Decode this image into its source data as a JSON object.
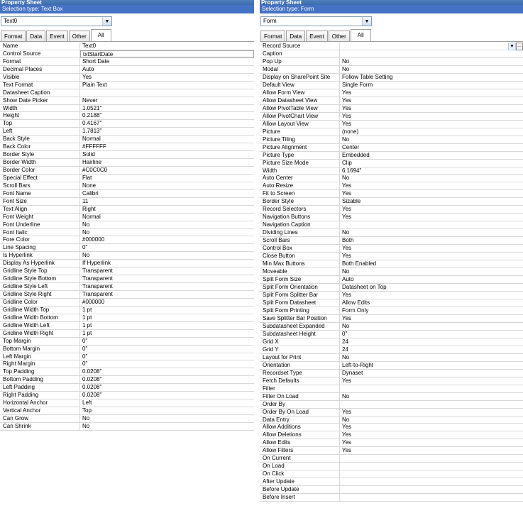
{
  "left": {
    "title": "Property Sheet",
    "selection_label": "Selection type:",
    "selection_value": "Text Box",
    "combo_value": "Text0",
    "tabs": [
      "Format",
      "Data",
      "Event",
      "Other",
      "All"
    ],
    "active_tab": "All",
    "rows": [
      {
        "name": "Name",
        "value": "Text0"
      },
      {
        "name": "Control Source",
        "value": "txtStartDate"
      },
      {
        "name": "Format",
        "value": "Short Date"
      },
      {
        "name": "Decimal Places",
        "value": "Auto"
      },
      {
        "name": "Visible",
        "value": "Yes"
      },
      {
        "name": "Text Format",
        "value": "Plain Text"
      },
      {
        "name": "Datasheet Caption",
        "value": ""
      },
      {
        "name": "Show Date Picker",
        "value": "Never"
      },
      {
        "name": "Width",
        "value": "1.0521\""
      },
      {
        "name": "Height",
        "value": "0.2188\""
      },
      {
        "name": "Top",
        "value": "0.4167\""
      },
      {
        "name": "Left",
        "value": "1.7813\""
      },
      {
        "name": "Back Style",
        "value": "Normal"
      },
      {
        "name": "Back Color",
        "value": "#FFFFFF"
      },
      {
        "name": "Border Style",
        "value": "Solid"
      },
      {
        "name": "Border Width",
        "value": "Hairline"
      },
      {
        "name": "Border Color",
        "value": "#C0C0C0"
      },
      {
        "name": "Special Effect",
        "value": "Flat"
      },
      {
        "name": "Scroll Bars",
        "value": "None"
      },
      {
        "name": "Font Name",
        "value": "Calibri"
      },
      {
        "name": "Font Size",
        "value": "11"
      },
      {
        "name": "Text Align",
        "value": "Right"
      },
      {
        "name": "Font Weight",
        "value": "Normal"
      },
      {
        "name": "Font Underline",
        "value": "No"
      },
      {
        "name": "Font Italic",
        "value": "No"
      },
      {
        "name": "Fore Color",
        "value": "#000000"
      },
      {
        "name": "Line Spacing",
        "value": "0\""
      },
      {
        "name": "Is Hyperlink",
        "value": "No"
      },
      {
        "name": "Display As Hyperlink",
        "value": "If Hyperlink"
      },
      {
        "name": "Gridline Style Top",
        "value": "Transparent"
      },
      {
        "name": "Gridline Style Bottom",
        "value": "Transparent"
      },
      {
        "name": "Gridline Style Left",
        "value": "Transparent"
      },
      {
        "name": "Gridline Style Right",
        "value": "Transparent"
      },
      {
        "name": "Gridline Color",
        "value": "#000000"
      },
      {
        "name": "Gridline Width Top",
        "value": "1 pt"
      },
      {
        "name": "Gridline Width Bottom",
        "value": "1 pt"
      },
      {
        "name": "Gridline Width Left",
        "value": "1 pt"
      },
      {
        "name": "Gridline Width Right",
        "value": "1 pt"
      },
      {
        "name": "Top Margin",
        "value": "0\""
      },
      {
        "name": "Bottom Margin",
        "value": "0\""
      },
      {
        "name": "Left Margin",
        "value": "0\""
      },
      {
        "name": "Right Margin",
        "value": "0\""
      },
      {
        "name": "Top Padding",
        "value": "0.0208\""
      },
      {
        "name": "Bottom Padding",
        "value": "0.0208\""
      },
      {
        "name": "Left Padding",
        "value": "0.0208\""
      },
      {
        "name": "Right Padding",
        "value": "0.0208\""
      },
      {
        "name": "Horizontal Anchor",
        "value": "Left"
      },
      {
        "name": "Vertical Anchor",
        "value": "Top"
      },
      {
        "name": "Can Grow",
        "value": "No"
      },
      {
        "name": "Can Shrink",
        "value": "No"
      }
    ]
  },
  "right": {
    "title": "Property Sheet",
    "selection_label": "Selection type:",
    "selection_value": "Form",
    "combo_value": "Form",
    "tabs": [
      "Format",
      "Data",
      "Event",
      "Other",
      "All"
    ],
    "active_tab": "All",
    "rows": [
      {
        "name": "Record Source",
        "value": ""
      },
      {
        "name": "Caption",
        "value": ""
      },
      {
        "name": "Pop Up",
        "value": "No"
      },
      {
        "name": "Modal",
        "value": "No"
      },
      {
        "name": "Display on SharePoint Site",
        "value": "Follow Table Setting"
      },
      {
        "name": "Default View",
        "value": "Single Form"
      },
      {
        "name": "Allow Form View",
        "value": "Yes"
      },
      {
        "name": "Allow Datasheet View",
        "value": "Yes"
      },
      {
        "name": "Allow PivotTable View",
        "value": "Yes"
      },
      {
        "name": "Allow PivotChart View",
        "value": "Yes"
      },
      {
        "name": "Allow Layout View",
        "value": "Yes"
      },
      {
        "name": "Picture",
        "value": "(none)"
      },
      {
        "name": "Picture Tiling",
        "value": "No"
      },
      {
        "name": "Picture Alignment",
        "value": "Center"
      },
      {
        "name": "Picture Type",
        "value": "Embedded"
      },
      {
        "name": "Picture Size Mode",
        "value": "Clip"
      },
      {
        "name": "Width",
        "value": "6.1694\""
      },
      {
        "name": "Auto Center",
        "value": "No"
      },
      {
        "name": "Auto Resize",
        "value": "Yes"
      },
      {
        "name": "Fit to Screen",
        "value": "Yes"
      },
      {
        "name": "Border Style",
        "value": "Sizable"
      },
      {
        "name": "Record Selectors",
        "value": "Yes"
      },
      {
        "name": "Navigation Buttons",
        "value": "Yes"
      },
      {
        "name": "Navigation Caption",
        "value": ""
      },
      {
        "name": "Dividing Lines",
        "value": "No"
      },
      {
        "name": "Scroll Bars",
        "value": "Both"
      },
      {
        "name": "Control Box",
        "value": "Yes"
      },
      {
        "name": "Close Button",
        "value": "Yes"
      },
      {
        "name": "Min Max Buttons",
        "value": "Both Enabled"
      },
      {
        "name": "Moveable",
        "value": "No"
      },
      {
        "name": "Split Form Size",
        "value": "Auto"
      },
      {
        "name": "Split Form Orientation",
        "value": "Datasheet on Top"
      },
      {
        "name": "Split Form Splitter Bar",
        "value": "Yes"
      },
      {
        "name": "Split Form Datasheet",
        "value": "Allow Edits"
      },
      {
        "name": "Split Form Printing",
        "value": "Form Only"
      },
      {
        "name": "Save Splitter Bar Position",
        "value": "Yes"
      },
      {
        "name": "Subdatasheet Expanded",
        "value": "No"
      },
      {
        "name": "Subdatasheet Height",
        "value": "0\""
      },
      {
        "name": "Grid X",
        "value": "24"
      },
      {
        "name": "Grid Y",
        "value": "24"
      },
      {
        "name": "Layout for Print",
        "value": "No"
      },
      {
        "name": "Orientation",
        "value": "Left-to-Right"
      },
      {
        "name": "Recordset Type",
        "value": "Dynaset"
      },
      {
        "name": "Fetch Defaults",
        "value": "Yes"
      },
      {
        "name": "Filter",
        "value": ""
      },
      {
        "name": "Filter On Load",
        "value": "No"
      },
      {
        "name": "Order By",
        "value": ""
      },
      {
        "name": "Order By On Load",
        "value": "Yes"
      },
      {
        "name": "Data Entry",
        "value": "No"
      },
      {
        "name": "Allow Additions",
        "value": "Yes"
      },
      {
        "name": "Allow Deletions",
        "value": "Yes"
      },
      {
        "name": "Allow Edits",
        "value": "Yes"
      },
      {
        "name": "Allow Filters",
        "value": "Yes"
      },
      {
        "name": "On Current",
        "value": ""
      },
      {
        "name": "On Load",
        "value": ""
      },
      {
        "name": "On Click",
        "value": ""
      },
      {
        "name": "After Update",
        "value": ""
      },
      {
        "name": "Before Update",
        "value": ""
      },
      {
        "name": "Before Insert",
        "value": ""
      }
    ]
  },
  "icons": {
    "dropdown": "chevron-down-icon",
    "ellipsis": "ellipsis-icon"
  },
  "glyphs": {
    "dropdown": "▼",
    "ellipsis": "..."
  },
  "colors": {
    "title_bar": "#4f81bd",
    "selection_bar": "#4472c4",
    "grid_line": "#d8d8d8"
  }
}
